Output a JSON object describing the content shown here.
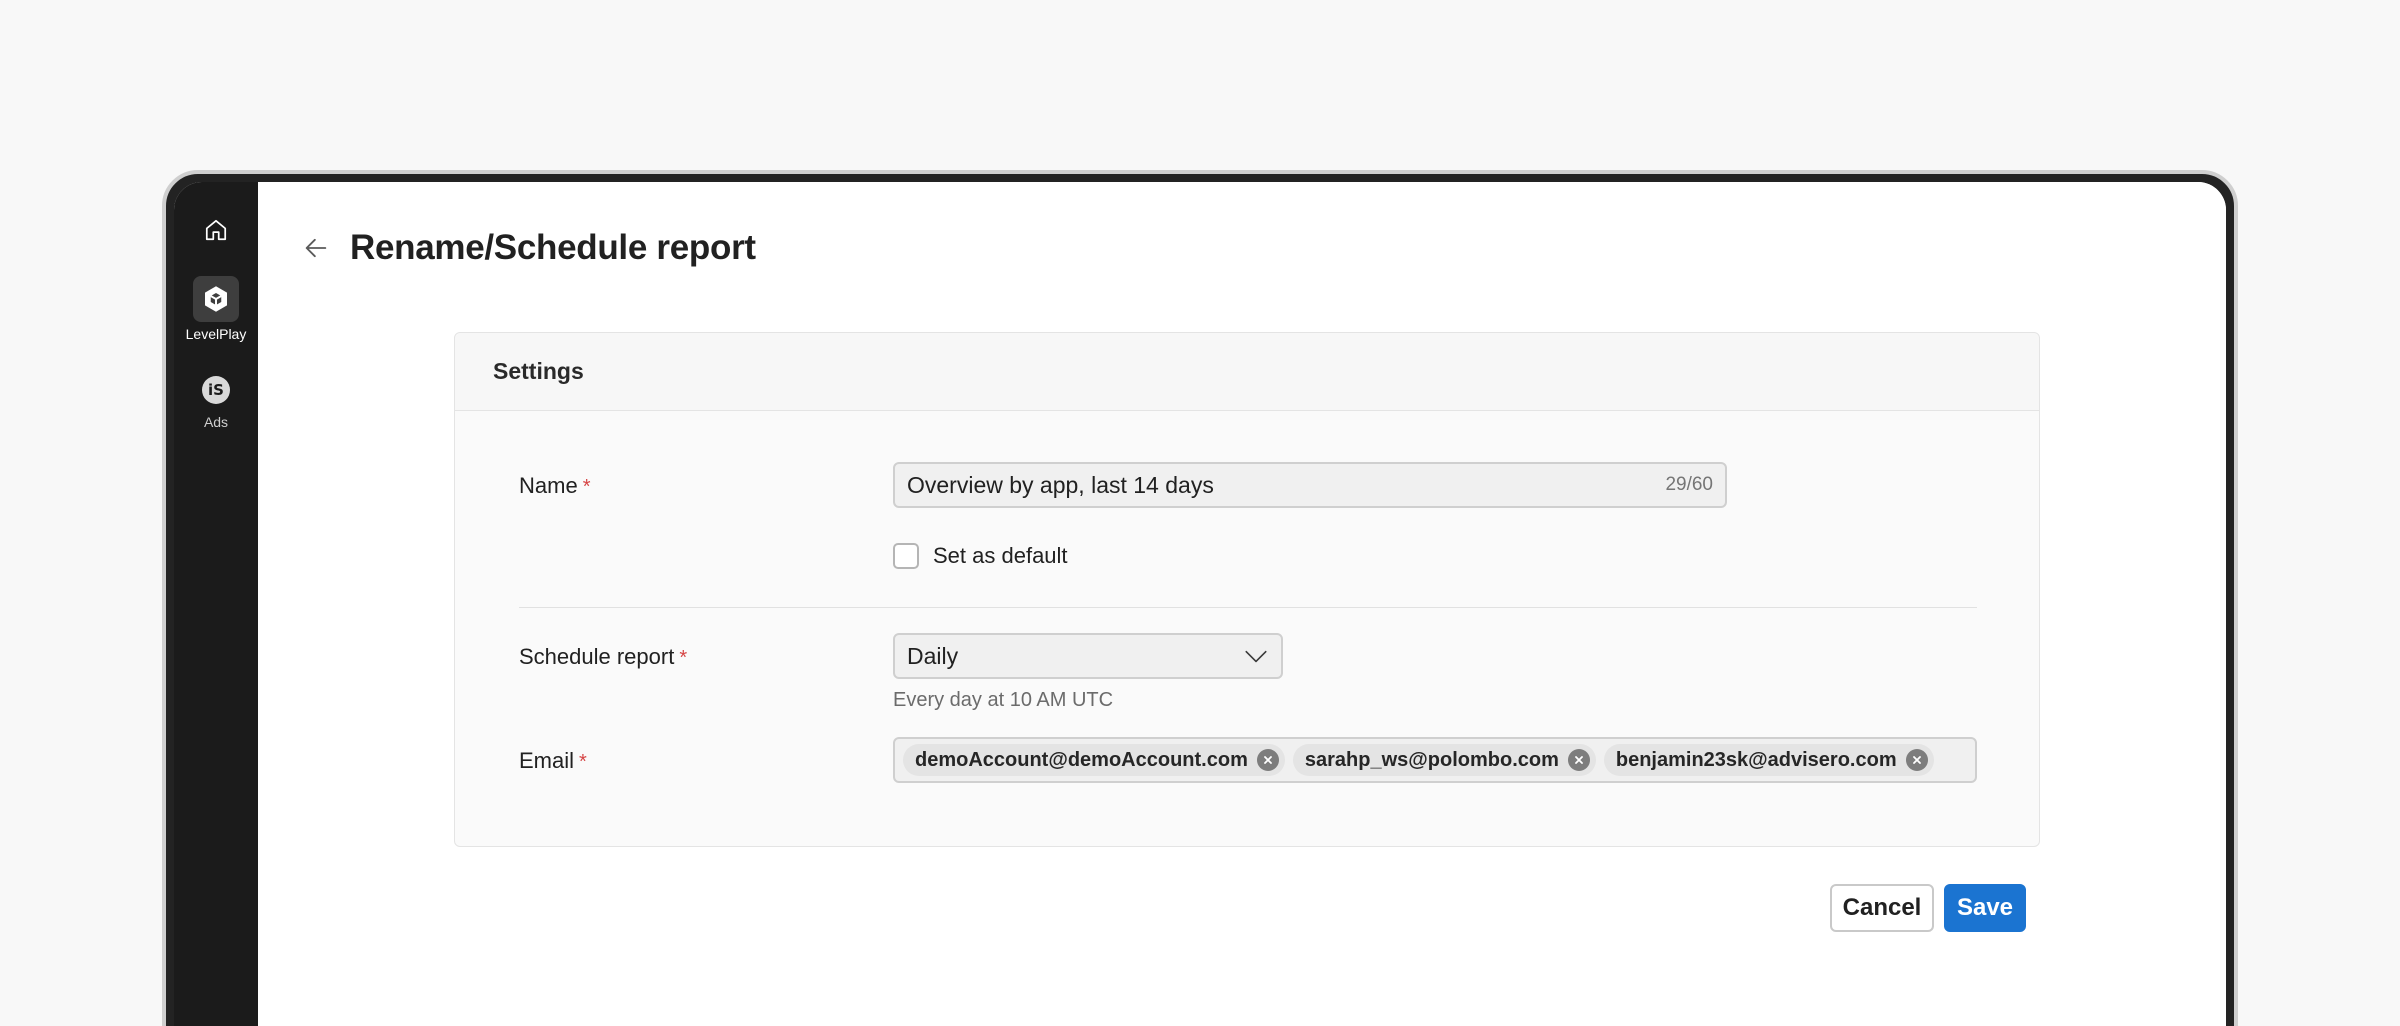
{
  "sidebar": {
    "items": [
      {
        "label": "",
        "icon": "home-icon"
      },
      {
        "label": "LevelPlay",
        "icon": "unity-logo-icon"
      },
      {
        "label": "Ads",
        "icon": "is-logo-icon",
        "icon_text": "iS"
      }
    ]
  },
  "header": {
    "title": "Rename/Schedule report"
  },
  "settings": {
    "title": "Settings",
    "name": {
      "label": "Name",
      "required_mark": "*",
      "value": "Overview by app, last 14 days",
      "char_count": "29/60"
    },
    "set_default": {
      "label": "Set as default",
      "checked": false
    },
    "schedule": {
      "label": "Schedule report",
      "required_mark": "*",
      "value": "Daily",
      "helper": "Every day at 10 AM UTC"
    },
    "email": {
      "label": "Email",
      "required_mark": "*",
      "chips": [
        "demoAccount@demoAccount.com",
        "sarahp_ws@polombo.com",
        "benjamin23sk@advisero.com"
      ]
    }
  },
  "actions": {
    "cancel_label": "Cancel",
    "save_label": "Save"
  },
  "colors": {
    "accent": "#1b74d1",
    "required": "#d64545",
    "sidebar": "#1b1b1b"
  }
}
